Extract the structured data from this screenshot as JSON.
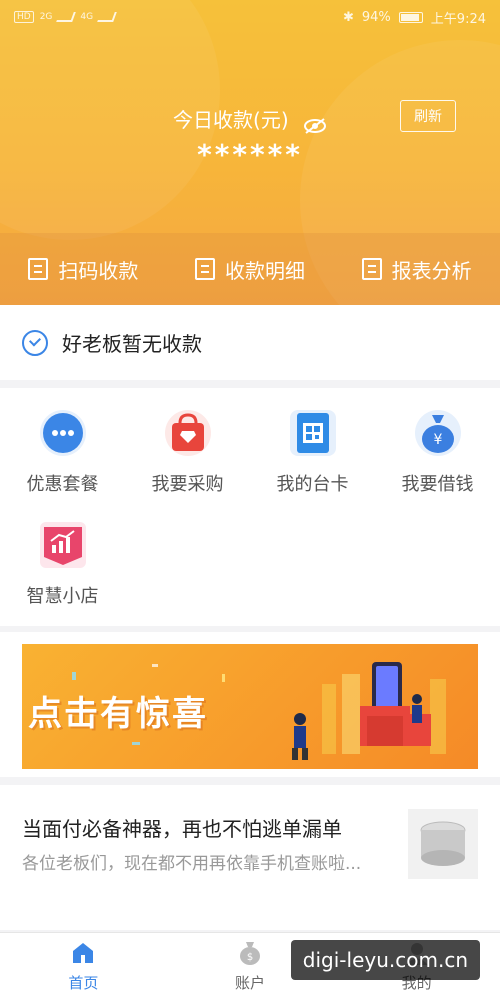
{
  "status_bar": {
    "left_chip": "HD",
    "net1": "2G",
    "net2": "4G",
    "battery_text": "94%",
    "time": "上午9:24"
  },
  "header": {
    "income_label": "今日收款(元)",
    "income_value": "******",
    "refresh_label": "刷新"
  },
  "quick_actions": [
    {
      "label": "扫码收款",
      "icon": "scan-icon"
    },
    {
      "label": "收款明细",
      "icon": "list-icon"
    },
    {
      "label": "报表分析",
      "icon": "report-icon"
    }
  ],
  "notice": {
    "text": "好老板暂无收款"
  },
  "grid": [
    {
      "label": "优惠套餐",
      "icon": "chat-bubble-icon",
      "color": "#3b86e6"
    },
    {
      "label": "我要采购",
      "icon": "shopping-bag-icon",
      "color": "#e8453c"
    },
    {
      "label": "我的台卡",
      "icon": "qr-card-icon",
      "color": "#2f8be6"
    },
    {
      "label": "我要借钱",
      "icon": "money-bag-icon",
      "color": "#3b7fe0"
    },
    {
      "label": "智慧小店",
      "icon": "store-chart-icon",
      "color": "#e8456b"
    }
  ],
  "banner": {
    "text": "点击有惊喜"
  },
  "article": {
    "title": "当面付必备神器，再也不怕逃单漏单",
    "description": "各位老板们，现在都不用再依靠手机查账啦..."
  },
  "tabbar": [
    {
      "label": "首页",
      "icon": "home-icon",
      "active": true
    },
    {
      "label": "账户",
      "icon": "money-bag-icon",
      "active": false
    },
    {
      "label": "我的",
      "icon": "user-icon",
      "active": false
    }
  ],
  "watermark": "digi-leyu.com.cn",
  "colors": {
    "header_gradient_top": "#f6c13a",
    "header_gradient_bottom": "#f4a643",
    "accent_blue": "#3b86e6"
  }
}
